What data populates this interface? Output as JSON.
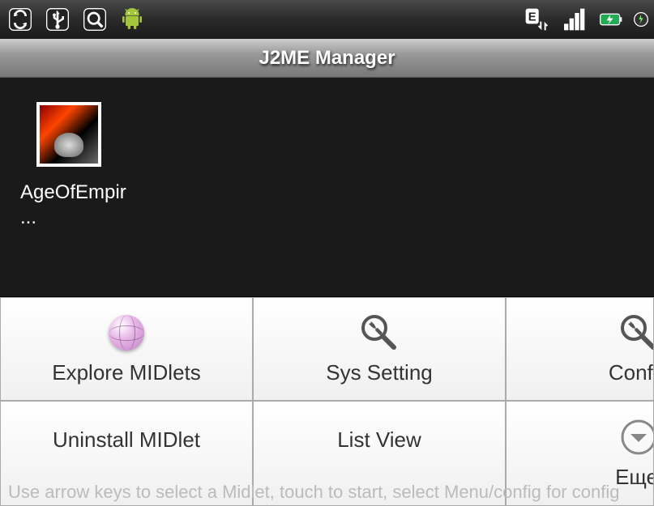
{
  "status_bar": {
    "icons_left": [
      "sync",
      "usb",
      "search",
      "android"
    ],
    "icons_right": [
      "edge",
      "signal",
      "battery",
      "charging"
    ]
  },
  "title_bar": {
    "title": "J2ME Manager"
  },
  "apps": [
    {
      "label": "AgeOfEmpir ...",
      "icon": "age-of-empires"
    }
  ],
  "menu": {
    "row1": [
      {
        "label": "Explore MIDlets",
        "icon": "globe"
      },
      {
        "label": "Sys Setting",
        "icon": "wrench"
      },
      {
        "label": "Config",
        "icon": "wrench"
      }
    ],
    "row2": [
      {
        "label": "Uninstall MIDlet",
        "icon": ""
      },
      {
        "label": "List View",
        "icon": ""
      },
      {
        "label": "Еще",
        "icon": "more"
      }
    ]
  },
  "hint": "Use arrow keys to select a Midlet, touch to start, select Menu/config for config"
}
